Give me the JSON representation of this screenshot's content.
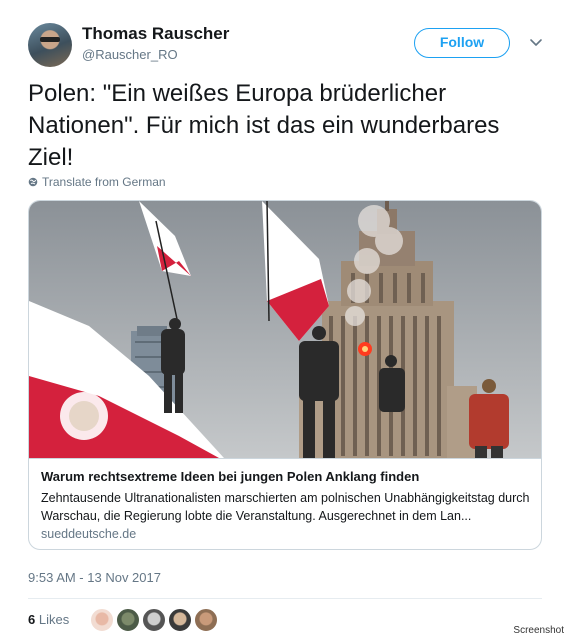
{
  "user": {
    "name": "Thomas Rauscher",
    "handle": "@Rauscher_RO"
  },
  "follow_label": "Follow",
  "tweet": {
    "text": "Polen: \"Ein weißes Europa brüderlicher Nationen\". Für mich ist das ein wunderbares Ziel!",
    "translate_label": "Translate from German"
  },
  "card": {
    "title": "Warum rechtsextreme Ideen bei jungen Polen Anklang finden",
    "description": "Zehntausende Ultranationalisten marschierten am polnischen Unabhängigkeitstag durch Warschau, die Regierung lobte die Veranstaltung. Ausgerechnet in dem Lan...",
    "domain": "sueddeutsche.de"
  },
  "timestamp": "9:53 AM - 13 Nov 2017",
  "likes": {
    "count": "6",
    "label": "Likes",
    "avatars": [
      "avatar-1",
      "avatar-2",
      "avatar-3",
      "avatar-4",
      "avatar-5"
    ]
  },
  "watermark": "Screenshot",
  "colors": {
    "accent": "#1da1f2",
    "text": "#14171a",
    "muted": "#657786",
    "border": "#ccd6dd",
    "flag_red": "#d4213d",
    "flag_white": "#ffffff"
  }
}
